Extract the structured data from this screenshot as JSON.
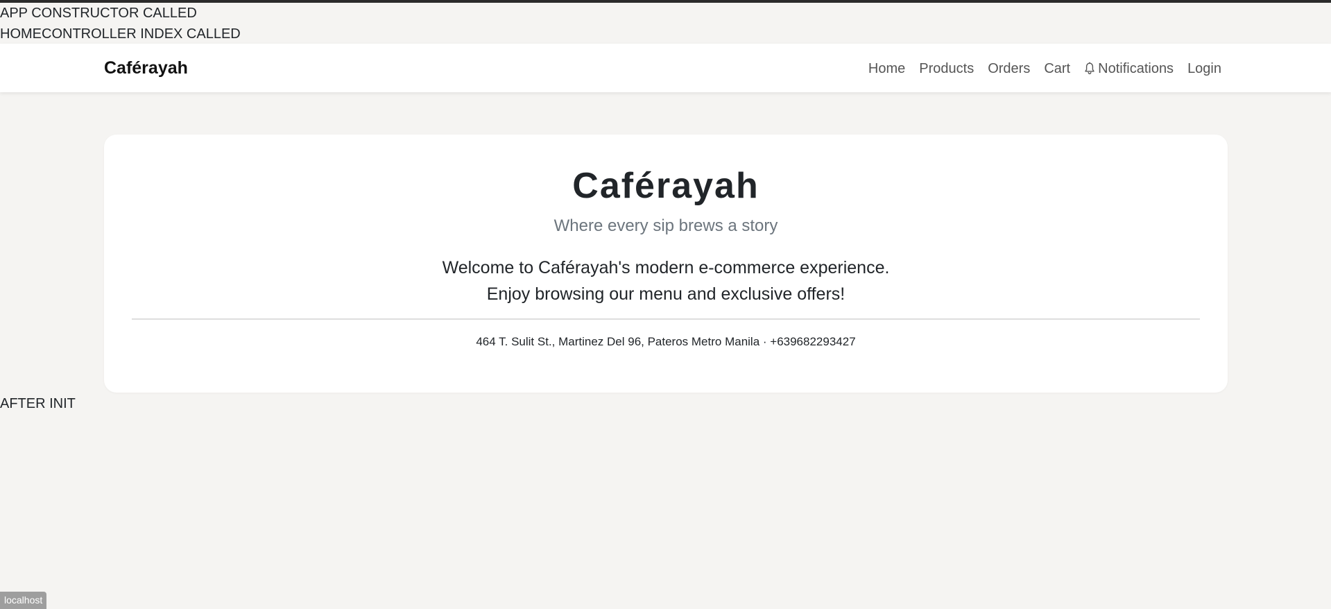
{
  "debug": {
    "line1": "APP CONSTRUCTOR CALLED",
    "line2": "HOMECONTROLLER INDEX CALLED",
    "line3": "AFTER INIT"
  },
  "navbar": {
    "brand": "Caférayah",
    "links": {
      "home": "Home",
      "products": "Products",
      "orders": "Orders",
      "cart": "Cart",
      "notifications": "Notifications",
      "login": "Login"
    },
    "notifications_icon": "bell-icon"
  },
  "hero": {
    "title": "Caférayah",
    "tagline": "Where every sip brews a story",
    "welcome_line1": "Welcome to Caférayah's modern e-commerce experience.",
    "welcome_line2": "Enjoy browsing our menu and exclusive offers!",
    "address": "464 T. Sulit St., Martinez Del 96, Pateros Metro Manila · +639682293427"
  },
  "status_bar": {
    "text": "localhost"
  },
  "colors": {
    "page_background": "#f5f4f2",
    "card_background": "#ffffff",
    "tagline": "#6c757d",
    "nav_link": "#555555",
    "text": "#212529"
  }
}
